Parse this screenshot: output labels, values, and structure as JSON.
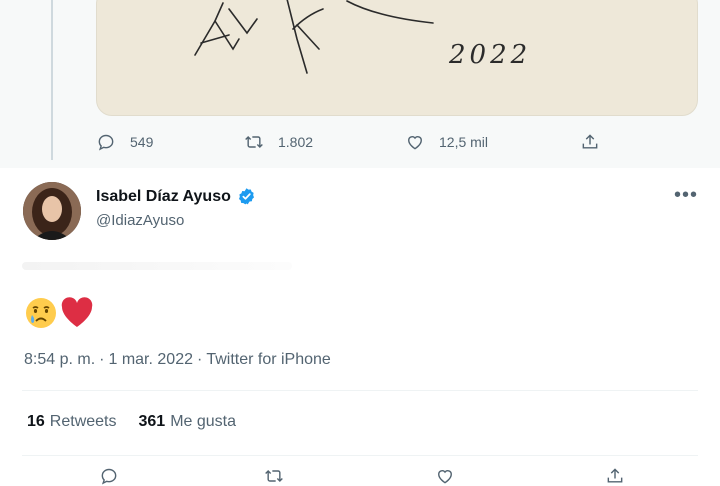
{
  "prev_tweet": {
    "sketch_text": "2022",
    "actions": {
      "reply_count": "549",
      "retweet_count": "1.802",
      "like_count": "12,5 mil"
    }
  },
  "tweet": {
    "author_name": "Isabel Díaz Ayuso",
    "handle": "@IdiazAyuso",
    "body_emojis": [
      "crying-face",
      "red-heart"
    ],
    "time": "8:54 p. m.",
    "date": "1 mar. 2022",
    "source": "Twitter for iPhone",
    "separator": "·",
    "retweets_count": "16",
    "retweets_label": "Retweets",
    "likes_count": "361",
    "likes_label": "Me gusta"
  },
  "icons": {
    "reply": "reply-icon",
    "retweet": "retweet-icon",
    "like": "heart-icon",
    "share": "share-icon",
    "verified": "verified-badge-icon",
    "more": "more-options-icon"
  },
  "colors": {
    "accent": "#1d9bf0",
    "text_primary": "#0f1419",
    "text_secondary": "#536471",
    "heart": "#e0245e"
  }
}
